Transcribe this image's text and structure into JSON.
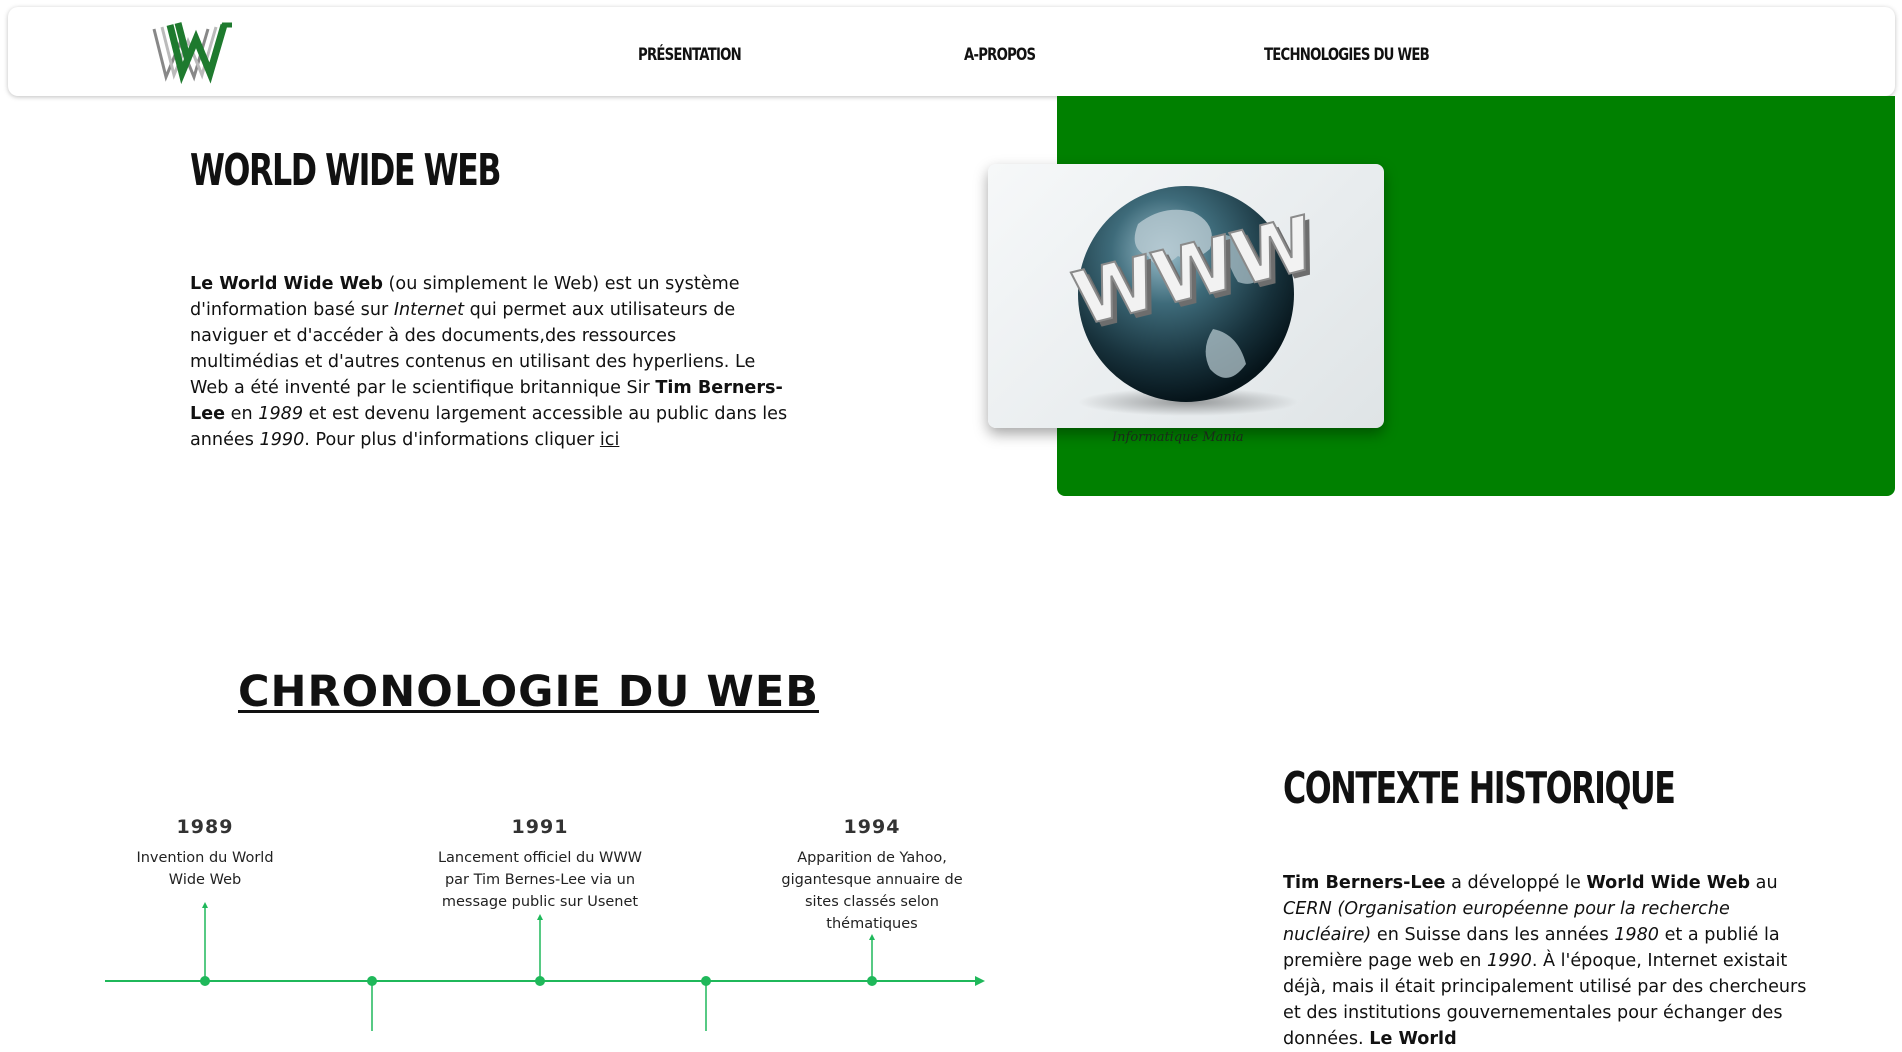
{
  "nav": {
    "logo_alt": "W",
    "links": [
      "PRÉSENTATION",
      "A-PROPOS",
      "TECHNOLOGIES DU WEB"
    ]
  },
  "hero": {
    "title": "WORLD WIDE WEB",
    "p1": "Le World Wide Web",
    "p2": " (ou simplement le Web) est un système d'information basé sur ",
    "p3": "Internet",
    "p4": " qui permet aux utilisateurs de naviguer et d'accéder à des documents,des ressources multimédias et d'autres contenus en utilisant des hyperliens. Le Web a été inventé par le scientifique britannique Sir ",
    "p5": "Tim Berners-Lee",
    "p6": " en ",
    "p7": "1989",
    "p8": " et est devenu largement accessible au public dans les années ",
    "p9": "1990",
    "p10": ". Pour plus d'informations cliquer ",
    "link": "ici"
  },
  "image": {
    "www_text": "WWW",
    "caption": "Informatique Mania"
  },
  "chronologie": {
    "title": "CHRONOLOGIE DU WEB",
    "events": [
      {
        "year": "1989",
        "desc": "Invention du World Wide Web"
      },
      {
        "year": "1991",
        "desc": "Lancement officiel du WWW par Tim Bernes-Lee via un message public sur Usenet"
      },
      {
        "year": "1994",
        "desc": "Apparition de Yahoo, gigantesque annuaire de sites classés selon thématiques"
      }
    ]
  },
  "contexte": {
    "title": "CONTEXTE HISTORIQUE",
    "c1": "Tim Berners-Lee",
    "c2": " a développé le ",
    "c3": "World Wide Web",
    "c4": " au ",
    "c5": "CERN (Organisation européenne pour la recherche nucléaire)",
    "c6": " en Suisse dans les années ",
    "c7": "1980",
    "c8": " et a publié la première page web en ",
    "c9": "1990",
    "c10": ". À l'époque, Internet existait déjà, mais il était principalement utilisé par des chercheurs et des institutions gouvernementales pour échanger des données. ",
    "c11": "Le World"
  },
  "colors": {
    "green_panel": "#008000",
    "timeline_green": "#1fb85a"
  }
}
